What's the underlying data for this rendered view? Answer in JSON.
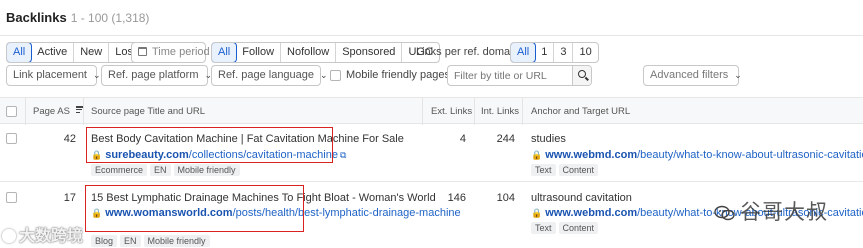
{
  "header": {
    "title": "Backlinks",
    "count": "1 - 100 (1,318)"
  },
  "filters": {
    "type_segment": [
      "All",
      "Active",
      "New",
      "Lost"
    ],
    "time_period": "Time period",
    "follow_segment": [
      "All",
      "Follow",
      "Nofollow",
      "Sponsored",
      "UGC"
    ],
    "links_per_domain_label": "Links per ref. domain",
    "links_per_domain": [
      "All",
      "1",
      "3",
      "10"
    ],
    "link_placement": "Link placement",
    "ref_page_platform": "Ref. page platform",
    "ref_page_language": "Ref. page language",
    "mobile_friendly_pages": "Mobile friendly pages",
    "filter_placeholder": "Filter by title or URL",
    "advanced_filters": "Advanced filters"
  },
  "table": {
    "columns": {
      "page_as": "Page AS",
      "source": "Source page Title and URL",
      "ext_links": "Ext. Links",
      "int_links": "Int. Links",
      "anchor": "Anchor and Target URL"
    },
    "rows": [
      {
        "page_as": "42",
        "title": "Best Body Cavitation Machine | Fat Cavitation Machine For Sale",
        "url_domain": "surebeauty.com",
        "url_path": "/collections/cavitation-machine",
        "tags": [
          "Ecommerce",
          "EN",
          "Mobile friendly"
        ],
        "ext_links": "4",
        "int_links": "244",
        "anchor_text": "studies",
        "target_domain": "www.webmd.com",
        "target_path": "/beauty/what-to-know-about-ultrasonic-cavitation",
        "target_tags": [
          "Text",
          "Content"
        ]
      },
      {
        "page_as": "17",
        "title": "15 Best Lymphatic Drainage Machines To Fight Bloat - Woman's World",
        "url_domain": "www.womansworld.com",
        "url_path": "/posts/health/best-lymphatic-drainage-machine",
        "tags": [
          "Blog",
          "EN",
          "Mobile friendly"
        ],
        "ext_links": "146",
        "int_links": "104",
        "anchor_text": "ultrasound cavitation",
        "target_domain": "www.webmd.com",
        "target_path": "/beauty/what-to-know-about-ultrasonic-cavitation",
        "target_tags": [
          "Text",
          "Content"
        ]
      }
    ]
  },
  "watermarks": {
    "left": "大数跨境",
    "right": "谷哥大叔"
  },
  "colors": {
    "accent": "#1a5fd0",
    "highlight_box": "#d9231f"
  }
}
